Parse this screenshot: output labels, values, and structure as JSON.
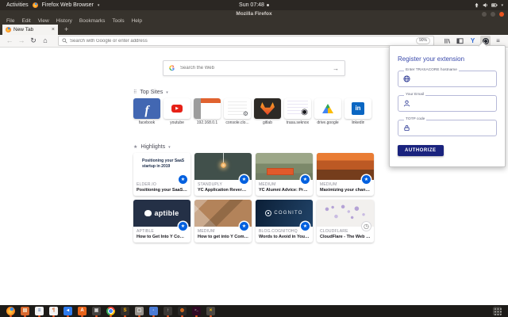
{
  "system_bar": {
    "activities_label": "Activities",
    "app_menu_label": "Firefox Web Browser",
    "caret": "▾",
    "clock": "Sun 07:48",
    "tray_icons": [
      "network-upload-icon",
      "volume-icon",
      "battery-icon",
      "caret-down-icon"
    ]
  },
  "titlebar": {
    "title": "Mozilla Firefox",
    "window_controls": [
      "minimize-button",
      "maximize-button",
      "close-button"
    ],
    "close_color": "#e95420"
  },
  "menubar": {
    "items": [
      "File",
      "Edit",
      "View",
      "History",
      "Bookmarks",
      "Tools",
      "Help"
    ]
  },
  "tabbar": {
    "active_tab_title": "New Tab",
    "close_glyph": "×",
    "new_tab_glyph": "+"
  },
  "navbar": {
    "back_glyph": "←",
    "forward_glyph": "→",
    "reload_glyph": "↻",
    "home_glyph": "⌂",
    "url_placeholder": "Search with Google or enter address",
    "zoom_badge": "90%",
    "menu_glyph": "≡",
    "y_extension_glyph": "Y",
    "right_icons": [
      "library-icon",
      "sidebar-icon",
      "y-extension-icon",
      "trasa-extension-icon",
      "menu-icon"
    ]
  },
  "newtab": {
    "search_placeholder": "Search the Web",
    "search_arrow": "→",
    "top_sites": {
      "heading": "Top Sites",
      "grid_glyph": "⠿",
      "caret": "▾",
      "tiles": [
        {
          "kind": "facebook",
          "label": "facebook",
          "bg": "#4267b2",
          "glyph": "f",
          "glyph_color": "#ffffff"
        },
        {
          "kind": "youtube",
          "label": "youtube",
          "bg": "#ffffff",
          "glyph": "▶",
          "glyph_color": "#ffffff"
        },
        {
          "kind": "router",
          "label": "192.168.0.1",
          "bg": "#ffffff",
          "glyph": "",
          "glyph_color": ""
        },
        {
          "kind": "console",
          "label": "console.clo...",
          "bg": "#ffffff",
          "glyph": "⚙",
          "glyph_color": "#5f6368"
        },
        {
          "kind": "gitlab",
          "label": "gitlab",
          "bg": "#2d2a26",
          "glyph": "",
          "glyph_color": ""
        },
        {
          "kind": "trasa",
          "label": "trasa.seknox",
          "bg": "#ffffff",
          "glyph": "◉",
          "glyph_color": "#17171b"
        },
        {
          "kind": "drive",
          "label": "drive.google",
          "bg": "#ffffff",
          "glyph": "",
          "glyph_color": ""
        },
        {
          "kind": "linkedin",
          "label": "linkedin",
          "bg": "#ffffff",
          "glyph": "in",
          "glyph_color": "#ffffff"
        }
      ]
    },
    "highlights": {
      "heading": "Highlights",
      "sparkle_glyph": "★",
      "caret": "▾",
      "cards": [
        {
          "kind": "saas",
          "domain": "ELDER.IO",
          "title": "Positioning your SaaS startup i…",
          "thumb_bg": "#ffffff",
          "thumb_text": "Positioning your SaaS startup in 2019",
          "badge": "bookmark"
        },
        {
          "kind": "lamp",
          "domain": "STANDUPLY",
          "title": "YC Application Reverse Engine…",
          "thumb_bg": "#41504b",
          "thumb_text": "",
          "badge": "bookmark"
        },
        {
          "kind": "ycphoto",
          "domain": "MEDIUM",
          "title": "YC Alumni Advice: Preparing f…",
          "thumb_bg": "#8a9478",
          "thumb_text": "",
          "badge": "bookmark"
        },
        {
          "kind": "audience",
          "domain": "MEDIUM",
          "title": "Maximizing your chances of ge…",
          "thumb_bg": "#d2622e",
          "thumb_text": "",
          "badge": "bookmark"
        },
        {
          "kind": "aptible",
          "domain": "APTIBLE",
          "title": "How to Get Into Y Combinator …",
          "thumb_bg": "#243046",
          "thumb_text": "aptible",
          "badge": "bookmark"
        },
        {
          "kind": "desk",
          "domain": "MEDIUM",
          "title": "How to get into Y Combinator …",
          "thumb_bg": "#b3835a",
          "thumb_text": "",
          "badge": "bookmark"
        },
        {
          "kind": "cognito",
          "domain": "BLOG.COGNITOHQ",
          "title": "Words to Avoid in Your YC Ap…",
          "thumb_bg": "#16314f",
          "thumb_text": "COGNITO",
          "badge": "bookmark"
        },
        {
          "kind": "map",
          "domain": "CLOUDFLARE",
          "title": "CloudFlare - The Web Perform…",
          "thumb_bg": "#f2f0ee",
          "thumb_text": "",
          "badge": "history"
        }
      ]
    }
  },
  "extension_popup": {
    "title": "Register your extension",
    "title_color": "#3949ab",
    "fields": [
      {
        "label": "Enter TRASACORE hostname",
        "icon": "globe-icon"
      },
      {
        "label": "Your Email",
        "icon": "person-icon"
      },
      {
        "label": "TOTP code",
        "icon": "lock-icon"
      }
    ],
    "authorize_label": "AUTHORIZE",
    "button_bg": "#1a237e"
  },
  "dock": {
    "items": [
      {
        "name": "firefox",
        "glyph": "",
        "glyph_color": ""
      },
      {
        "name": "file-manager",
        "bg": "#d9692f",
        "glyph": "▤",
        "glyph_color": "#f7e3c9"
      },
      {
        "name": "libreoffice-writer",
        "bg": "#f2f2f2",
        "glyph": "≡",
        "glyph_color": "#2a5699"
      },
      {
        "name": "document-viewer",
        "bg": "#f2f2f2",
        "glyph": "¶",
        "glyph_color": "#d9692f"
      },
      {
        "name": "vscode",
        "bg": "#2f7cee",
        "glyph": "◂",
        "glyph_color": "#ffffff"
      },
      {
        "name": "ubuntu-software",
        "bg": "#e8641a",
        "glyph": "A",
        "glyph_color": "#ffffff"
      },
      {
        "name": "screenshot-tool",
        "bg": "#44423f",
        "glyph": "▣",
        "glyph_color": "#cfcecc"
      },
      {
        "name": "chromium",
        "glyph": "",
        "glyph_color": ""
      },
      {
        "name": "sublime-text",
        "bg": "#33302c",
        "glyph": "S",
        "glyph_color": "#ffb300"
      },
      {
        "name": "archive-manager",
        "bg": "#98938c",
        "glyph": "▢",
        "glyph_color": "#f2f2f2"
      },
      {
        "name": "remmina",
        "bg": "#4b7bd4",
        "glyph": "◦",
        "glyph_color": "#ffffff"
      },
      {
        "name": "software-updater",
        "bg": "#3b3835",
        "glyph": "↑",
        "glyph_color": "#d6d4d1"
      },
      {
        "name": "blender",
        "bg": "#2b2a28",
        "glyph": "◍",
        "glyph_color": "#ff7a1a"
      },
      {
        "name": "terminal",
        "bg": "#300a24",
        "glyph": ">_",
        "glyph_color": "#ffffff"
      },
      {
        "name": "system-tools",
        "bg": "#4a4742",
        "glyph": "×",
        "glyph_color": "#ffc107"
      }
    ],
    "show_apps_icon": "show-applications-grid-icon"
  }
}
